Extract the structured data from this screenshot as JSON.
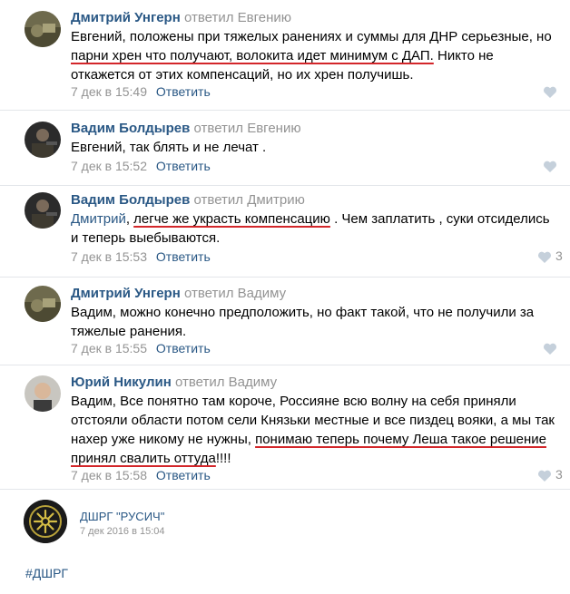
{
  "comments": [
    {
      "author": "Дмитрий Унгерн",
      "replied": "ответил Евгению",
      "lines": [
        [
          {
            "t": "Евгений, положены при тяжелых ранениях и суммы для ДНР серьезные, но"
          }
        ],
        [
          {
            "t": "парни хрен что получают, волокита идет минимум с ДАП.",
            "u": true
          },
          {
            "t": " Никто не"
          }
        ],
        [
          {
            "t": "откажется от этих компенсаций, но их хрен получишь."
          }
        ]
      ],
      "date": "7 дек в 15:49",
      "reply": "Ответить"
    },
    {
      "author": "Вадим Болдырев",
      "replied": "ответил Евгению",
      "lines": [
        [
          {
            "t": "Евгений, так блять и не лечат ."
          }
        ]
      ],
      "date": "7 дек в 15:52",
      "reply": "Ответить"
    },
    {
      "author": "Вадим Болдырев",
      "replied": "ответил Дмитрию",
      "lines": [
        [
          {
            "t": "Дмитрий",
            "m": true
          },
          {
            "t": ", "
          },
          {
            "t": "легче же украсть компенсацию",
            "u": true
          },
          {
            "t": " . Чем заплатить , суки отсиделись"
          }
        ],
        [
          {
            "t": "и теперь выебываются."
          }
        ]
      ],
      "date": "7 дек в 15:53",
      "reply": "Ответить",
      "likes": "3"
    },
    {
      "author": "Дмитрий Унгерн",
      "replied": "ответил Вадиму",
      "lines": [
        [
          {
            "t": "Вадим, можно конечно предположить, но факт такой, что не получили за"
          }
        ],
        [
          {
            "t": "тяжелые ранения."
          }
        ]
      ],
      "date": "7 дек в 15:55",
      "reply": "Ответить"
    },
    {
      "author": "Юрий Никулин",
      "replied": "ответил Вадиму",
      "lines": [
        [
          {
            "t": "Вадим, Все понятно там короче, Россияне всю волну на себя приняли"
          }
        ],
        [
          {
            "t": "отстояли области потом сели Князьки местные и все пиздец вояки, а мы так"
          }
        ],
        [
          {
            "t": "нахер уже никому не нужны, ",
            "u": false
          },
          {
            "t": "понимаю теперь почему Леша такое решение",
            "u": true
          }
        ],
        [
          {
            "t": "принял свалить оттуда",
            "u": true
          },
          {
            "t": "!!!!"
          }
        ]
      ],
      "date": "7 дек в 15:58",
      "reply": "Ответить",
      "likes": "3"
    }
  ],
  "group": {
    "name": "ДШРГ \"РУСИЧ\"",
    "date": "7 дек 2016 в 15:04",
    "hashtag": "#ДШРГ"
  },
  "colors": {
    "link": "#2a5885",
    "muted": "#939393",
    "underline": "#d3262a"
  }
}
